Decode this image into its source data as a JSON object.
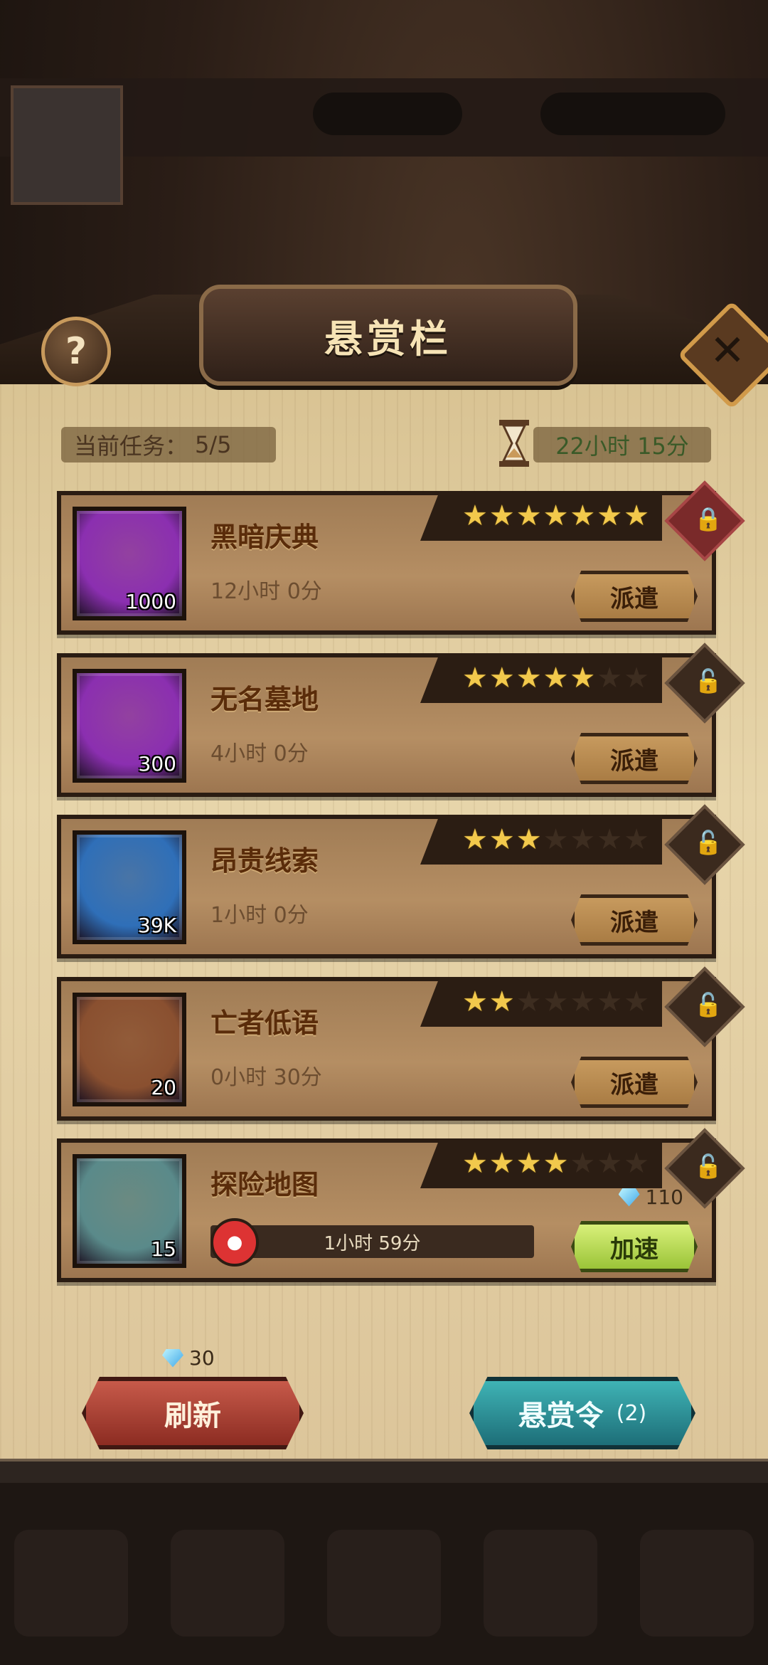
{
  "header": {
    "title": "悬赏栏",
    "help_icon": "?",
    "close_icon": "✕"
  },
  "status": {
    "current_label": "当前任务：",
    "current_value": "5/5",
    "timer": "22小时 15分"
  },
  "bounties": [
    {
      "name": "黑暗庆典",
      "duration": "12小时 0分",
      "item_count": "1000",
      "item_color": "#8b2fb0",
      "stars_on": 7,
      "locked": true,
      "action": "派遣"
    },
    {
      "name": "无名墓地",
      "duration": "4小时 0分",
      "item_count": "300",
      "item_color": "#8b2fb0",
      "stars_on": 5,
      "locked": false,
      "action": "派遣"
    },
    {
      "name": "昂贵线索",
      "duration": "1小时 0分",
      "item_count": "39K",
      "item_color": "#2f6fb8",
      "stars_on": 3,
      "locked": false,
      "action": "派遣"
    },
    {
      "name": "亡者低语",
      "duration": "0小时 30分",
      "item_count": "20",
      "item_color": "#8a5030",
      "stars_on": 2,
      "locked": false,
      "action": "派遣"
    },
    {
      "name": "探险地图",
      "progress_text": "1小时 59分",
      "item_count": "15",
      "item_color": "#5a8a8a",
      "stars_on": 4,
      "locked": false,
      "action": "加速",
      "speed_cost": "110"
    }
  ],
  "footer": {
    "refresh_label": "刷新",
    "refresh_cost": "30",
    "bounty_token_label": "悬赏令",
    "bounty_token_count": "(2)"
  },
  "colors": {
    "accent_gold": "#f2c94c",
    "parchment": "#e7d5aa"
  }
}
